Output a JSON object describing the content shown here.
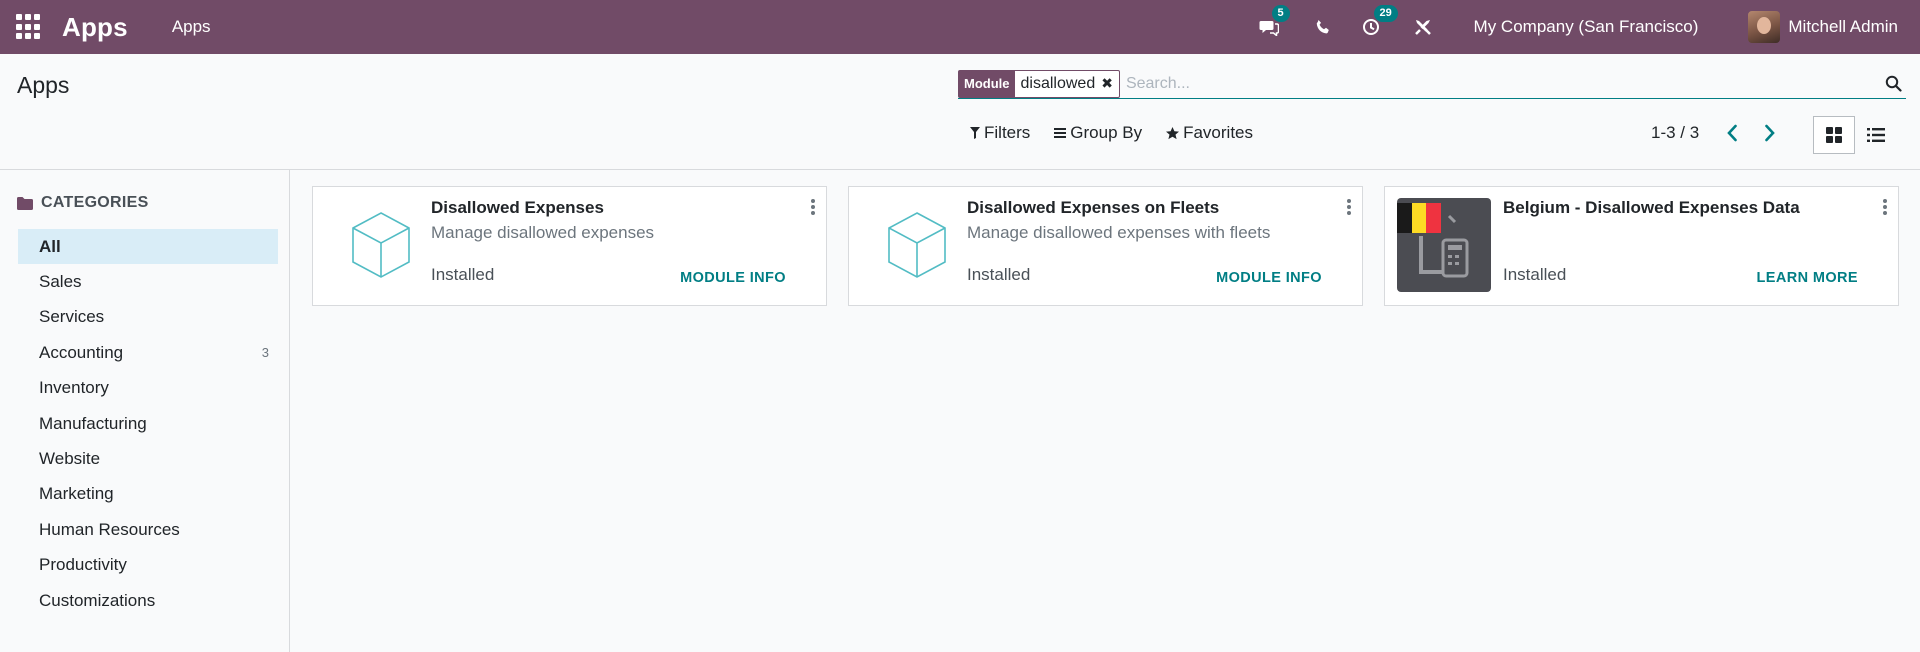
{
  "navbar": {
    "brand": "Apps",
    "menu_label": "Apps",
    "messages_count": "5",
    "activities_count": "29",
    "company": "My Company (San Francisco)",
    "user_name": "Mitchell Admin",
    "icons": [
      "apps-grid-icon",
      "chat-icon",
      "phone-icon",
      "clock-icon",
      "tools-icon"
    ]
  },
  "control_panel": {
    "title": "Apps",
    "facet": {
      "label": "Module",
      "value": "disallowed"
    },
    "search_placeholder": "Search...",
    "filters_label": "Filters",
    "groupby_label": "Group By",
    "favorites_label": "Favorites",
    "pager_value": "1-3 / 3",
    "active_view": "kanban"
  },
  "sidebar": {
    "header": "CATEGORIES",
    "items": [
      {
        "label": "All",
        "count": "",
        "active": true
      },
      {
        "label": "Sales",
        "count": ""
      },
      {
        "label": "Services",
        "count": ""
      },
      {
        "label": "Accounting",
        "count": "3"
      },
      {
        "label": "Inventory",
        "count": ""
      },
      {
        "label": "Manufacturing",
        "count": ""
      },
      {
        "label": "Website",
        "count": ""
      },
      {
        "label": "Marketing",
        "count": ""
      },
      {
        "label": "Human Resources",
        "count": ""
      },
      {
        "label": "Productivity",
        "count": ""
      },
      {
        "label": "Customizations",
        "count": ""
      }
    ]
  },
  "cards": [
    {
      "title": "Disallowed Expenses",
      "summary": "Manage disallowed expenses",
      "status": "Installed",
      "action": "MODULE INFO",
      "icon": "cube-icon"
    },
    {
      "title": "Disallowed Expenses on Fleets",
      "summary": "Manage disallowed expenses with fleets",
      "status": "Installed",
      "action": "MODULE INFO",
      "icon": "cube-icon"
    },
    {
      "title": "Belgium - Disallowed Expenses Data",
      "summary": "",
      "status": "Installed",
      "action": "LEARN MORE",
      "icon": "belgium-document-icon"
    }
  ],
  "colors": {
    "brand": "#714b67",
    "accent": "#017e84",
    "active_category_bg": "#d9edf7",
    "cube_stroke": "#52bcc4",
    "flag_black": "#1a1a1a",
    "flag_yellow": "#fdda24",
    "flag_red": "#ef3340"
  }
}
